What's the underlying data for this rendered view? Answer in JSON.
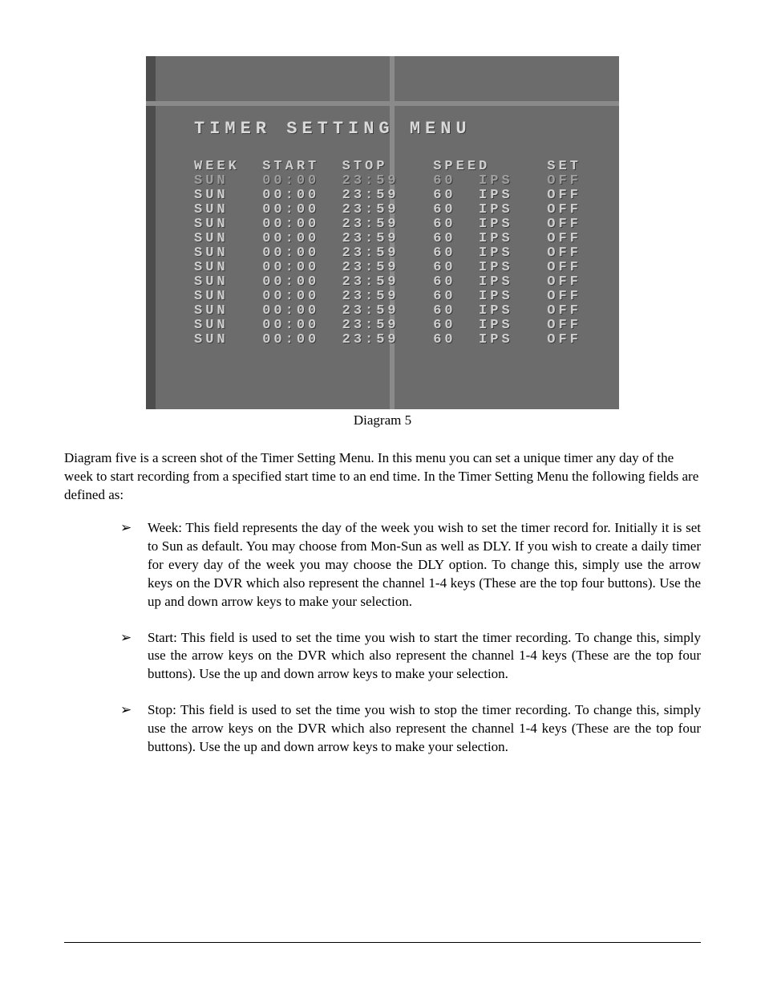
{
  "osd": {
    "title": "TIMER SETTING MENU",
    "headers": {
      "week": "WEEK",
      "start": "START",
      "stop": "STOP",
      "speed": "SPEED",
      "set": "SET"
    },
    "rows": [
      {
        "week": "SUN",
        "start": "00:00",
        "stop": "23:59",
        "speed": "60",
        "unit": "IPS",
        "set": "OFF",
        "selected": true
      },
      {
        "week": "SUN",
        "start": "00:00",
        "stop": "23:59",
        "speed": "60",
        "unit": "IPS",
        "set": "OFF",
        "selected": false
      },
      {
        "week": "SUN",
        "start": "00:00",
        "stop": "23:59",
        "speed": "60",
        "unit": "IPS",
        "set": "OFF",
        "selected": false
      },
      {
        "week": "SUN",
        "start": "00:00",
        "stop": "23:59",
        "speed": "60",
        "unit": "IPS",
        "set": "OFF",
        "selected": false
      },
      {
        "week": "SUN",
        "start": "00:00",
        "stop": "23:59",
        "speed": "60",
        "unit": "IPS",
        "set": "OFF",
        "selected": false
      },
      {
        "week": "SUN",
        "start": "00:00",
        "stop": "23:59",
        "speed": "60",
        "unit": "IPS",
        "set": "OFF",
        "selected": false
      },
      {
        "week": "SUN",
        "start": "00:00",
        "stop": "23:59",
        "speed": "60",
        "unit": "IPS",
        "set": "OFF",
        "selected": false
      },
      {
        "week": "SUN",
        "start": "00:00",
        "stop": "23:59",
        "speed": "60",
        "unit": "IPS",
        "set": "OFF",
        "selected": false
      },
      {
        "week": "SUN",
        "start": "00:00",
        "stop": "23:59",
        "speed": "60",
        "unit": "IPS",
        "set": "OFF",
        "selected": false
      },
      {
        "week": "SUN",
        "start": "00:00",
        "stop": "23:59",
        "speed": "60",
        "unit": "IPS",
        "set": "OFF",
        "selected": false
      },
      {
        "week": "SUN",
        "start": "00:00",
        "stop": "23:59",
        "speed": "60",
        "unit": "IPS",
        "set": "OFF",
        "selected": false
      },
      {
        "week": "SUN",
        "start": "00:00",
        "stop": "23:59",
        "speed": "60",
        "unit": "IPS",
        "set": "OFF",
        "selected": false
      }
    ]
  },
  "caption": "Diagram 5",
  "intro": "Diagram five is a screen shot of the Timer Setting Menu. In this menu you can set a unique timer any day of the week to start recording from a specified start time to an end time. In the Timer Setting Menu the following fields are defined as:",
  "bullets": [
    "Week: This field represents the day of the week you wish to set the timer record for. Initially it is set to Sun as default. You may choose from Mon-Sun as well as DLY. If you wish to create a daily timer for every day of the week you may choose the DLY option. To change this, simply use the arrow keys on the DVR which also represent the channel 1-4 keys (These are the top four buttons). Use the up and down arrow keys to make your selection.",
    "Start: This field is used to set the time you wish to start the timer recording. To change this, simply use the arrow keys on the DVR which also represent the channel 1-4 keys (These are the top four buttons). Use the up and down arrow keys to make your selection.",
    "Stop: This field is used to set the time you wish to stop the timer recording. To change this, simply use the arrow keys on the DVR which also represent the channel 1-4 keys (These are the top four buttons). Use the up and down arrow keys to make your selection."
  ]
}
